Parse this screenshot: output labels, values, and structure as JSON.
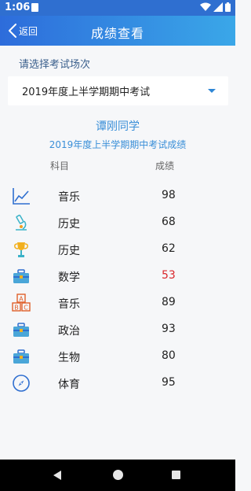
{
  "status_bar": {
    "time": "1:06",
    "icons": [
      "sd-card-icon",
      "wifi-icon",
      "signal-icon",
      "battery-icon"
    ]
  },
  "header": {
    "back_label": "返回",
    "title": "成绩查看",
    "accent_colors": [
      "#2d6cdb",
      "#3aa7e8"
    ]
  },
  "exam": {
    "prompt": "请选择考试场次",
    "selected": "2019年度上半学期期中考试"
  },
  "report": {
    "student": "谭刚同学",
    "title": "2019年度上半学期期中考试成绩",
    "col_subject": "科目",
    "col_score": "成绩",
    "fail_color": "#d9262b",
    "rows": [
      {
        "icon": "line-chart-icon",
        "subject": "音乐",
        "score": "98"
      },
      {
        "icon": "microscope-icon",
        "subject": "历史",
        "score": "68"
      },
      {
        "icon": "trophy-icon",
        "subject": "历史",
        "score": "62"
      },
      {
        "icon": "toolbox-icon",
        "subject": "数学",
        "score": "53"
      },
      {
        "icon": "abc-blocks-icon",
        "subject": "音乐",
        "score": "89"
      },
      {
        "icon": "toolbox-icon",
        "subject": "政治",
        "score": "93"
      },
      {
        "icon": "toolbox-icon",
        "subject": "生物",
        "score": "80"
      },
      {
        "icon": "compass-icon",
        "subject": "体育",
        "score": "95"
      }
    ]
  }
}
